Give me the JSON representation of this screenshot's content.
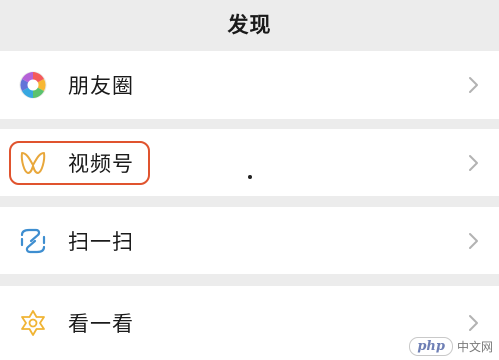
{
  "header": {
    "title": "发现"
  },
  "items": [
    {
      "label": "朋友圈",
      "icon": "moments-icon"
    },
    {
      "label": "视频号",
      "icon": "channels-icon"
    },
    {
      "label": "扫一扫",
      "icon": "scan-icon"
    },
    {
      "label": "看一看",
      "icon": "top-stories-icon"
    }
  ],
  "watermark": {
    "logo": "php",
    "text": "中文网"
  },
  "colors": {
    "highlight": "#e0532e",
    "background": "#ececec"
  }
}
